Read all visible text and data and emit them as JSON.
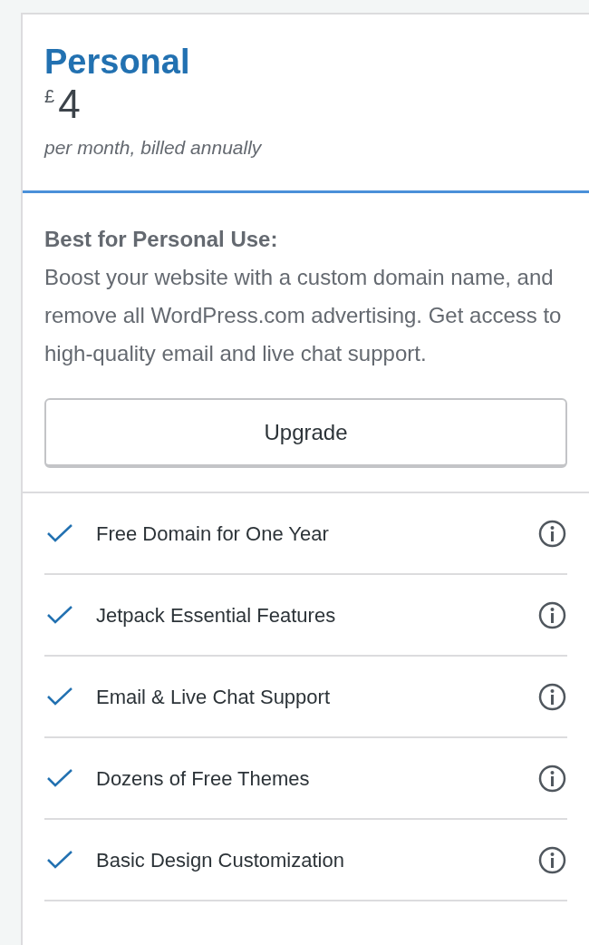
{
  "plan": {
    "name": "Personal",
    "currency": "£",
    "price": "4",
    "billing": "per month, billed annually"
  },
  "description": {
    "heading": "Best for Personal Use:",
    "body": "Boost your website with a custom domain name, and remove all WordPress.com advertising. Get access to high-quality email and live chat support."
  },
  "button": {
    "label": "Upgrade"
  },
  "features": [
    {
      "label": "Free Domain for One Year",
      "included": true
    },
    {
      "label": "Jetpack Essential Features",
      "included": true
    },
    {
      "label": "Email & Live Chat Support",
      "included": true
    },
    {
      "label": "Dozens of Free Themes",
      "included": true
    },
    {
      "label": "Basic Design Customization",
      "included": true
    }
  ]
}
